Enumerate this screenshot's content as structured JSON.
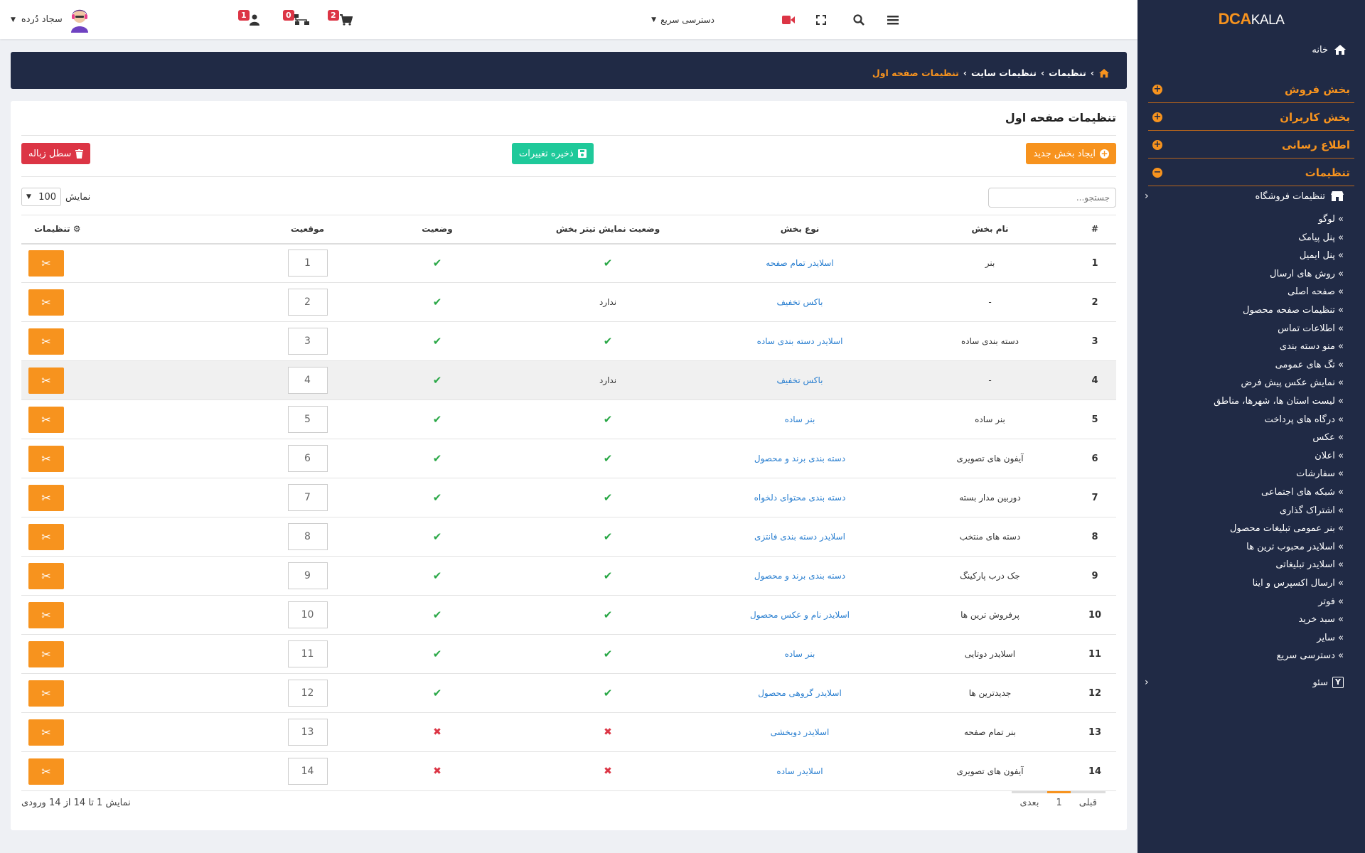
{
  "brand": {
    "logo_part1": "DCA",
    "logo_part2": "KALA"
  },
  "topbar": {
    "user_name": "سجاد دُرده",
    "quick_access": "دسترسی سریع",
    "cart_count": "2",
    "orders_count": "0",
    "users_count": "1"
  },
  "breadcrumb": {
    "item1": "تنظیمات",
    "item2": "تنظیمات سایت",
    "current": "تنظیمات صفحه اول",
    "sep": "›"
  },
  "sidebar": {
    "home": "خانه",
    "sections": [
      "بخش فروش",
      "بخش کاربران",
      "اطلاع رسانی",
      "تنظیمات"
    ],
    "store_settings": "تنظیمات فروشگاه",
    "sub_items": [
      "» لوگو",
      "» پنل پیامک",
      "» پنل ایمیل",
      "» روش های ارسال",
      "» صفحه اصلی",
      "» تنظیمات صفحه محصول",
      "» اطلاعات تماس",
      "» منو دسته بندی",
      "»  تگ های عمومی",
      "»  نمایش عکس پیش فرض",
      "» لیست استان ها، شهرها، مناطق",
      "» درگاه های پرداخت",
      "»  عکس",
      "» اعلان",
      "»  سفارشات",
      "» شبکه های اجتماعی",
      "» اشتراک گذاری",
      "» بنر عمومی تبلیغات محصول",
      "» اسلایدر محبوب ترین ها",
      "» اسلایدر تبلیغاتی",
      "» ارسال اکسپرس و اینا",
      "» فوتر",
      "» سبد خرید",
      "» سایر",
      "» دسترسی سریع"
    ],
    "seo": "سئو"
  },
  "page": {
    "title": "تنظیمات صفحه اول",
    "new_section_button": "ایجاد بخش جدید",
    "save_button": "ذخیره تغییرات",
    "trash_button": "سطل زباله",
    "search_placeholder": "جستجو...",
    "show_label": "نمایش",
    "page_size": "100",
    "columns": [
      "#",
      "نام بخش",
      "نوع بخش",
      "وضعیت نمایش تیتر بخش",
      "وضعیت",
      "موقعیت",
      "تنظیمات"
    ],
    "rows": [
      {
        "num": "1",
        "name": "بنر",
        "type": "اسلایدر تمام صفحه",
        "title_status": "check",
        "status": "check",
        "position": "1"
      },
      {
        "num": "2",
        "name": "-",
        "type": "باکس تخفیف",
        "title_status": "ندارد",
        "status": "check",
        "position": "2"
      },
      {
        "num": "3",
        "name": "دسته بندی ساده",
        "type": "اسلایدر دسته بندی ساده",
        "title_status": "check",
        "status": "check",
        "position": "3"
      },
      {
        "num": "4",
        "name": "-",
        "type": "باکس تخفیف",
        "title_status": "ندارد",
        "status": "check",
        "position": "4"
      },
      {
        "num": "5",
        "name": "بنر ساده",
        "type": "بنر ساده",
        "title_status": "check",
        "status": "check",
        "position": "5"
      },
      {
        "num": "6",
        "name": "آیفون های تصویری",
        "type": "دسته بندی برند و محصول",
        "title_status": "check",
        "status": "check",
        "position": "6"
      },
      {
        "num": "7",
        "name": "دوربین مدار بسته",
        "type": "دسته بندی محتوای دلخواه",
        "title_status": "check",
        "status": "check",
        "position": "7"
      },
      {
        "num": "8",
        "name": "دسته های منتخب",
        "type": "اسلایدر دسته بندی فانتزی",
        "title_status": "check",
        "status": "check",
        "position": "8"
      },
      {
        "num": "9",
        "name": "جک درب پارکینگ",
        "type": "دسته بندی برند و محصول",
        "title_status": "check",
        "status": "check",
        "position": "9"
      },
      {
        "num": "10",
        "name": "پرفروش ترین ها",
        "type": "اسلایدر نام و عکس محصول",
        "title_status": "check",
        "status": "check",
        "position": "10"
      },
      {
        "num": "11",
        "name": "اسلایدر دوتایی",
        "type": "بنر ساده",
        "title_status": "check",
        "status": "check",
        "position": "11"
      },
      {
        "num": "12",
        "name": "جدیدترین ها",
        "type": "اسلایدر گروهی محصول",
        "title_status": "check",
        "status": "check",
        "position": "12"
      },
      {
        "num": "13",
        "name": "بنر تمام صفحه",
        "type": "اسلایدر دوبخشی",
        "title_status": "cross",
        "status": "cross",
        "position": "13"
      },
      {
        "num": "14",
        "name": "آیفون های تصویری",
        "type": "اسلایدر ساده",
        "title_status": "cross",
        "status": "cross",
        "position": "14"
      }
    ],
    "footer_info": "نمایش 1 تا 14 از 14 ورودی",
    "pager": {
      "prev": "قبلی",
      "page": "1",
      "next": "بعدی"
    }
  },
  "colors": {
    "sidebar": "#202a45",
    "accent": "#f7931e",
    "success": "#28a745",
    "danger": "#dc3545",
    "save": "#1fc99a",
    "link": "#2a7fd0"
  }
}
